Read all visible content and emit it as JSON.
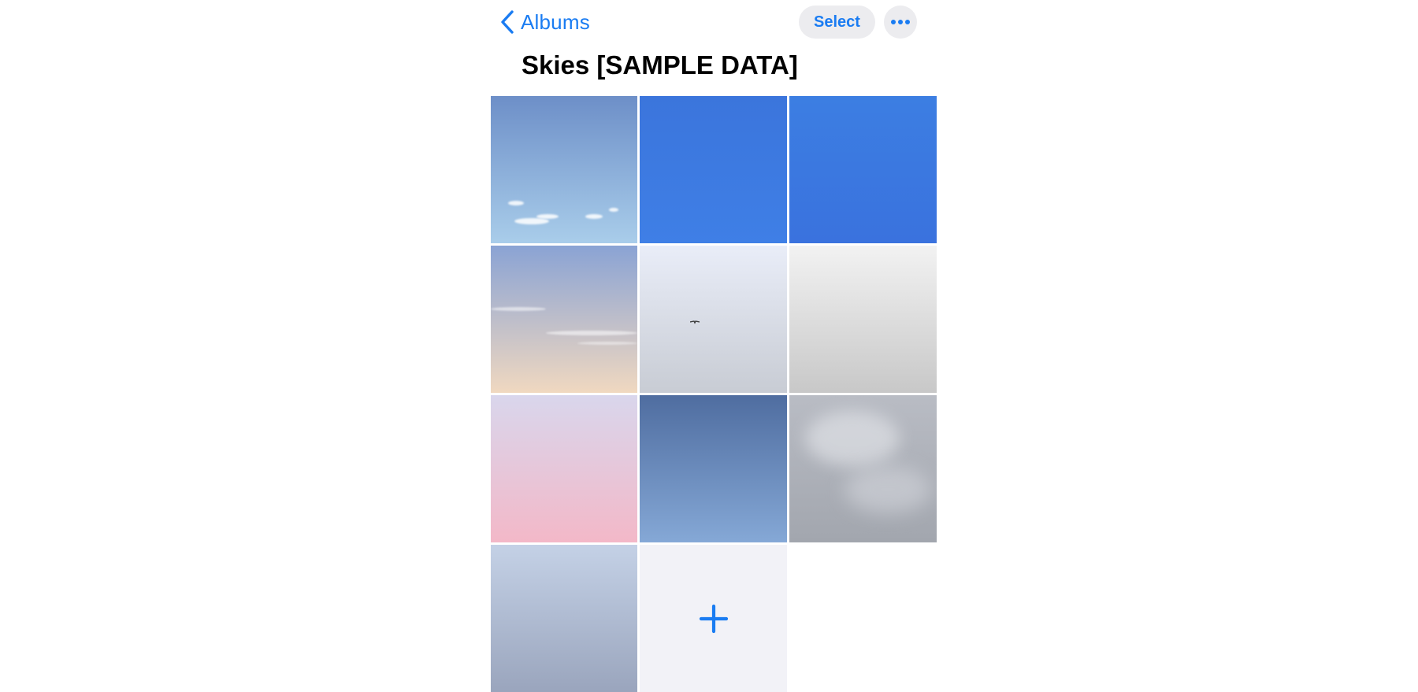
{
  "nav": {
    "back_label": "Albums",
    "select_label": "Select",
    "more_icon": "ellipsis-icon",
    "back_icon": "chevron-left-icon"
  },
  "album": {
    "title": "Skies [SAMPLE DATA]"
  },
  "photos": [
    {
      "name": "photo-1",
      "desc": "blue sky with small clouds",
      "colors": [
        "#6d8fc8",
        "#a9cdea"
      ]
    },
    {
      "name": "photo-2",
      "desc": "deep blue sky",
      "colors": [
        "#3b75dc",
        "#3f7fe6"
      ]
    },
    {
      "name": "photo-3",
      "desc": "deep blue sky",
      "colors": [
        "#3c7ee2",
        "#3a72de"
      ]
    },
    {
      "name": "photo-4",
      "desc": "sky with sunset horizon",
      "colors": [
        "#8aa3d4",
        "#f0d8c0"
      ]
    },
    {
      "name": "photo-5",
      "desc": "pale sky with bird",
      "colors": [
        "#e9edf8",
        "#c8ccd4"
      ]
    },
    {
      "name": "photo-6",
      "desc": "grey overcast sky",
      "colors": [
        "#f2f2f2",
        "#c8c8c8"
      ]
    },
    {
      "name": "photo-7",
      "desc": "pink sunset sky",
      "colors": [
        "#d9d6ec",
        "#f3b8c8"
      ]
    },
    {
      "name": "photo-8",
      "desc": "dusky blue sky",
      "colors": [
        "#4f6da0",
        "#85a8d6"
      ]
    },
    {
      "name": "photo-9",
      "desc": "cloudy grey sky",
      "colors": [
        "#b9bcc4",
        "#a2a6ae"
      ]
    },
    {
      "name": "photo-10",
      "desc": "hazy blue sky",
      "colors": [
        "#c4d1e6",
        "#9aa5bd"
      ]
    }
  ],
  "add_tile": {
    "icon": "plus-icon",
    "color": "#1a7cf2"
  },
  "colors": {
    "accent": "#1a7cf2",
    "button_bg": "#ececef",
    "add_tile_bg": "#f2f2f7"
  }
}
